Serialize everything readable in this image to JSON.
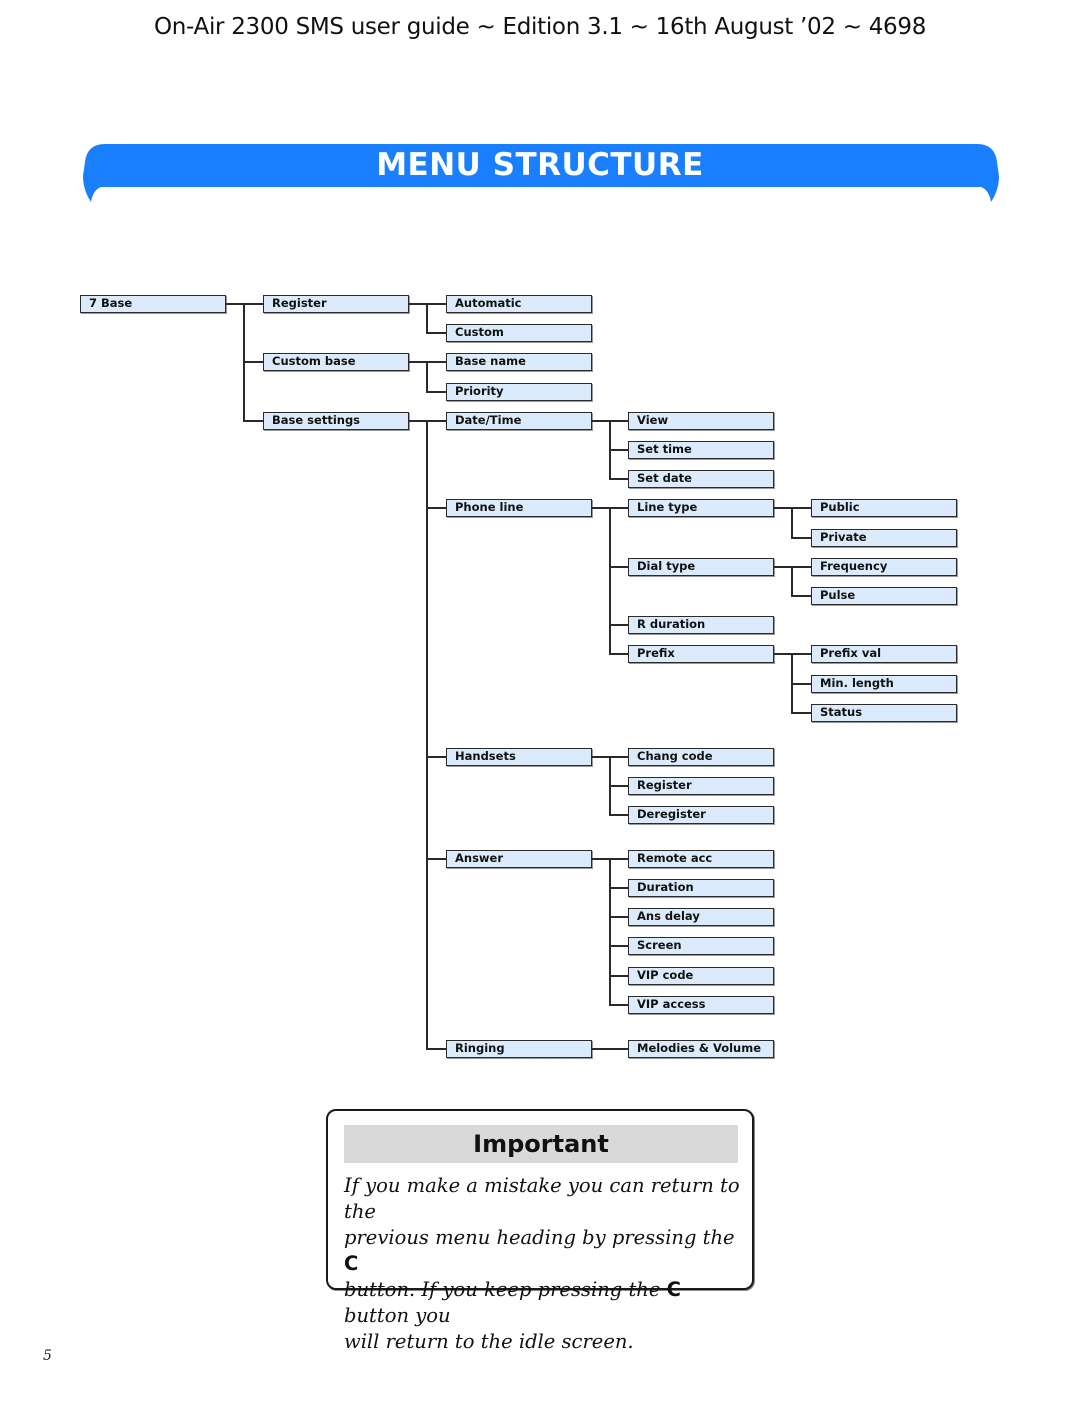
{
  "header": {
    "title": "On-Air 2300 SMS user guide ~ Edition 3.1 ~ 16th August ’02 ~ 4698"
  },
  "banner": {
    "title": "MENU STRUCTURE",
    "color": "#1a7ffc"
  },
  "menu_tree": {
    "label": "7 Base",
    "children": [
      {
        "label": "Register",
        "children": [
          {
            "label": "Automatic"
          },
          {
            "label": "Custom"
          }
        ]
      },
      {
        "label": "Custom base",
        "children": [
          {
            "label": "Base name"
          },
          {
            "label": "Priority"
          }
        ]
      },
      {
        "label": "Base settings",
        "children": [
          {
            "label": "Date/Time",
            "children": [
              {
                "label": "View"
              },
              {
                "label": "Set time"
              },
              {
                "label": "Set date"
              }
            ]
          },
          {
            "label": "Phone line",
            "children": [
              {
                "label": "Line type",
                "children": [
                  {
                    "label": "Public"
                  },
                  {
                    "label": "Private"
                  }
                ]
              },
              {
                "label": "Dial type",
                "children": [
                  {
                    "label": "Frequency"
                  },
                  {
                    "label": "Pulse"
                  }
                ]
              },
              {
                "label": "R duration"
              },
              {
                "label": "Prefix",
                "children": [
                  {
                    "label": "Prefix val"
                  },
                  {
                    "label": "Min. length"
                  },
                  {
                    "label": "Status"
                  }
                ]
              }
            ]
          },
          {
            "label": "Handsets",
            "children": [
              {
                "label": "Chang code"
              },
              {
                "label": "Register"
              },
              {
                "label": "Deregister"
              }
            ]
          },
          {
            "label": "Answer",
            "children": [
              {
                "label": "Remote acc"
              },
              {
                "label": "Duration"
              },
              {
                "label": "Ans delay"
              },
              {
                "label": "Screen"
              },
              {
                "label": "VIP code"
              },
              {
                "label": "VIP access"
              }
            ]
          },
          {
            "label": "Ringing",
            "children": [
              {
                "label": "Melodies & Volume"
              }
            ]
          }
        ]
      }
    ]
  },
  "important": {
    "heading": "Important",
    "line1": "If you make a mistake you can return to the",
    "line2_a": "previous menu heading by pressing the ",
    "key": "C",
    "line3_a": "button. If you keep pressing the ",
    "line3_b": " button you",
    "line4": "will return to the idle screen."
  },
  "page_number": "5"
}
